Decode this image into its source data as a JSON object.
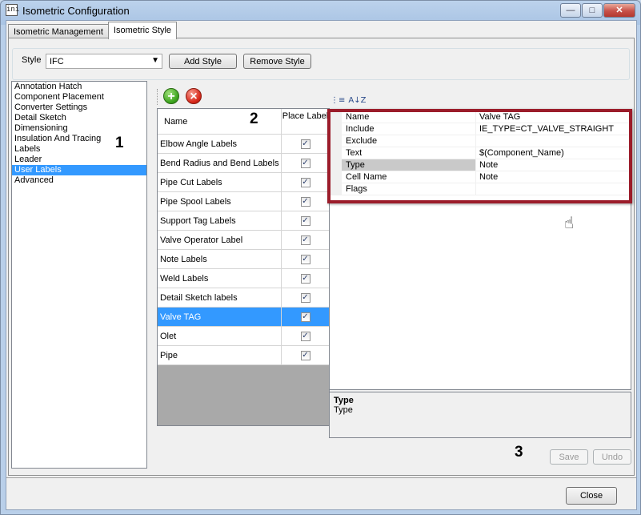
{
  "window": {
    "title": "Isometric Configuration",
    "app_icon": "ini"
  },
  "controls": {
    "minimize": "—",
    "maximize": "□",
    "close": "✕"
  },
  "tabs": [
    {
      "label": "Isometric Management",
      "active": false
    },
    {
      "label": "Isometric Style",
      "active": true
    }
  ],
  "style": {
    "label": "Style",
    "value": "IFC",
    "add_label": "Add Style",
    "remove_label": "Remove Style"
  },
  "categories": {
    "items": [
      "Annotation Hatch",
      "Component Placement",
      "Converter Settings",
      "Detail Sketch",
      "Dimensioning",
      "Insulation And Tracing",
      "Labels",
      "Leader",
      "User Labels",
      "Advanced"
    ],
    "selected_index": 8
  },
  "annotations": {
    "n1": "1",
    "n2": "2",
    "n3": "3"
  },
  "labels_grid": {
    "header_name": "Name",
    "header_place": "Place Label",
    "rows": [
      {
        "name": "Elbow Angle Labels",
        "checked": true
      },
      {
        "name": "Bend Radius and Bend Labels",
        "checked": true
      },
      {
        "name": "Pipe Cut Labels",
        "checked": true
      },
      {
        "name": "Pipe Spool Labels",
        "checked": true
      },
      {
        "name": "Support Tag Labels",
        "checked": true
      },
      {
        "name": "Valve Operator Label",
        "checked": true
      },
      {
        "name": "Note Labels",
        "checked": true
      },
      {
        "name": "Weld Labels",
        "checked": true
      },
      {
        "name": "Detail Sketch labels",
        "checked": true
      },
      {
        "name": "Valve TAG",
        "checked": true,
        "selected": true
      },
      {
        "name": "Olet",
        "checked": true
      },
      {
        "name": "Pipe",
        "checked": true
      }
    ]
  },
  "properties": {
    "sort_categorized_icon": "⋮≡",
    "sort_alpha_icon": "A↓Z",
    "rows": [
      {
        "name": "Name",
        "value": "Valve TAG"
      },
      {
        "name": "Include",
        "value": "IE_TYPE=CT_VALVE_STRAIGHT"
      },
      {
        "name": "Exclude",
        "value": ""
      },
      {
        "name": "Text",
        "value": "$(Component_Name)"
      },
      {
        "name": "Type",
        "value": "Note",
        "selected": true
      },
      {
        "name": "Cell Name",
        "value": "Note"
      },
      {
        "name": "Flags",
        "value": ""
      }
    ],
    "description_title": "Type",
    "description_text": "Type"
  },
  "footer": {
    "save_label": "Save",
    "undo_label": "Undo",
    "close_label": "Close"
  },
  "colors": {
    "selection": "#3399ff",
    "highlight_border": "#9b1c2a"
  }
}
